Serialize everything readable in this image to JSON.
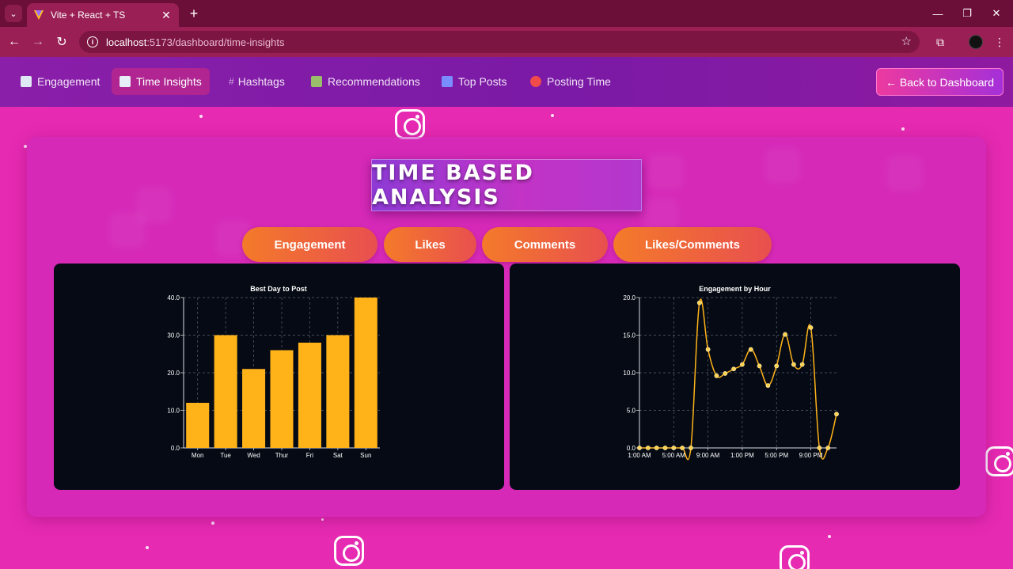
{
  "browser": {
    "tab_title": "Vite + React + TS",
    "url_host": "localhost",
    "url_path": ":5173/dashboard/time-insights"
  },
  "nav": {
    "items": [
      {
        "label": "Engagement",
        "icon": "chart-line-icon"
      },
      {
        "label": "Time Insights",
        "icon": "bar-chart-icon",
        "active": true
      },
      {
        "label": "Hashtags",
        "icon": "hash-icon"
      },
      {
        "label": "Recommendations",
        "icon": "notepad-icon"
      },
      {
        "label": "Top Posts",
        "icon": "top-arrow-icon"
      },
      {
        "label": "Posting Time",
        "icon": "alarm-clock-icon"
      }
    ],
    "back_label": "← Back to  Dashboard"
  },
  "main": {
    "heading": "TIME BASED ANALYSIS",
    "pills": [
      "Engagement",
      "Likes",
      "Comments",
      "Likes/Comments"
    ]
  },
  "colors": {
    "bar": "#ffb319",
    "line": "#ffb319",
    "card": "#050a14",
    "grid": "#5a6272"
  },
  "chart_data": [
    {
      "type": "bar",
      "title": "Best Day to Post",
      "categories": [
        "Mon",
        "Tue",
        "Wed",
        "Thur",
        "Fri",
        "Sat",
        "Sun"
      ],
      "values": [
        12,
        30,
        21,
        26,
        28,
        30,
        40
      ],
      "ylim": [
        0,
        40
      ],
      "yticks": [
        "0.0",
        "10.0",
        "20.0",
        "30.0",
        "40.0"
      ],
      "grid": true
    },
    {
      "type": "line",
      "title": "Engagement by Hour",
      "x": [
        "1:00 AM",
        "2:00 AM",
        "3:00 AM",
        "4:00 AM",
        "5:00 AM",
        "6:00 AM",
        "7:00 AM",
        "8:00 AM",
        "9:00 AM",
        "10:00 AM",
        "11:00 AM",
        "12:00 PM",
        "1:00 PM",
        "2:00 PM",
        "3:00 PM",
        "4:00 PM",
        "5:00 PM",
        "6:00 PM",
        "7:00 PM",
        "8:00 PM",
        "9:00 PM",
        "10:00 PM",
        "11:00 PM",
        "12:00 AM"
      ],
      "values": [
        0,
        0,
        0,
        0,
        0,
        0,
        0,
        19.3,
        13.1,
        9.6,
        9.9,
        10.5,
        11.1,
        13.1,
        10.9,
        8.3,
        10.9,
        15.1,
        11.1,
        11.1,
        16.0,
        0,
        0,
        4.5
      ],
      "xtick_labels": [
        "1:00 AM",
        "5:00 AM",
        "9:00 AM",
        "1:00 PM",
        "5:00 PM",
        "9:00 PM"
      ],
      "ylim": [
        0,
        20
      ],
      "yticks": [
        "0.0",
        "5.0",
        "10.0",
        "15.0",
        "20.0"
      ],
      "grid": true
    }
  ]
}
